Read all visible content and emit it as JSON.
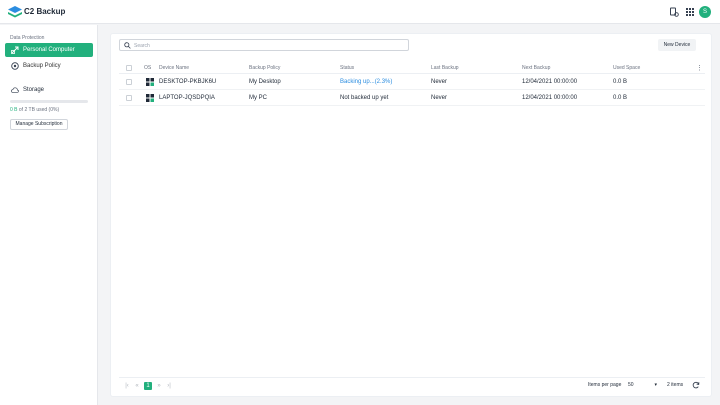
{
  "app": {
    "title": "C2 Backup",
    "brand_color": "#22b07d",
    "link_color": "#2b8de0"
  },
  "topbar": {
    "icons": [
      "notification-settings-icon",
      "apps-grid-icon"
    ],
    "avatar_initial": "S"
  },
  "sidebar": {
    "section_label": "Data Protection",
    "items": [
      {
        "label": "Personal Computer",
        "icon": "computer-link-icon",
        "active": true
      },
      {
        "label": "Backup Policy",
        "icon": "policy-icon",
        "active": false
      }
    ],
    "storage": {
      "label": "Storage",
      "icon": "cloud-icon",
      "used": "0 B",
      "text_rest": " of 2 TB used (0%)",
      "percent": 0,
      "button_label": "Manage Subscription"
    }
  },
  "main": {
    "search_placeholder": "Search",
    "new_device_label": "New Device",
    "columns": [
      "OS",
      "Device Name",
      "Backup Policy",
      "Status",
      "Last Backup",
      "Next Backup",
      "Used Space"
    ],
    "rows": [
      {
        "os": "windows-icon",
        "device": "DESKTOP-PKBJK6U",
        "policy": "My Desktop",
        "status": "Backing up...(2.3%)",
        "status_link": true,
        "last": "Never",
        "next": "12/04/2021 00:00:00",
        "used": "0.0 B"
      },
      {
        "os": "windows-icon",
        "device": "LAPTOP-JQSDPQIA",
        "policy": "My PC",
        "status": "Not backed up yet",
        "status_link": false,
        "last": "Never",
        "next": "12/04/2021 00:00:00",
        "used": "0.0 B"
      }
    ]
  },
  "footer": {
    "current_page": "1",
    "items_per_page_label": "Items per page",
    "items_per_page_value": "50",
    "items_count": "2 items"
  }
}
